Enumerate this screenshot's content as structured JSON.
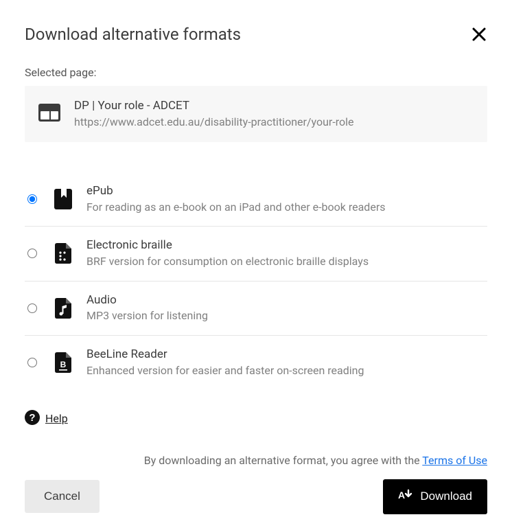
{
  "dialog": {
    "title": "Download alternative formats",
    "selected_label": "Selected page:",
    "page": {
      "title": "DP | Your role - ADCET",
      "url": "https://www.adcet.edu.au/disability-practitioner/your-role"
    }
  },
  "options": [
    {
      "name": "ePub",
      "desc": "For reading as an e-book on an iPad and other e-book readers",
      "selected": true
    },
    {
      "name": "Electronic braille",
      "desc": "BRF version for consumption on electronic braille displays",
      "selected": false
    },
    {
      "name": "Audio",
      "desc": "MP3 version for listening",
      "selected": false
    },
    {
      "name": "BeeLine Reader",
      "desc": "Enhanced version for easier and faster on-screen reading",
      "selected": false
    }
  ],
  "help": {
    "label": "Help"
  },
  "terms": {
    "prefix": "By downloading an alternative format, you agree with the ",
    "link": "Terms of Use"
  },
  "buttons": {
    "cancel": "Cancel",
    "download": "Download"
  }
}
